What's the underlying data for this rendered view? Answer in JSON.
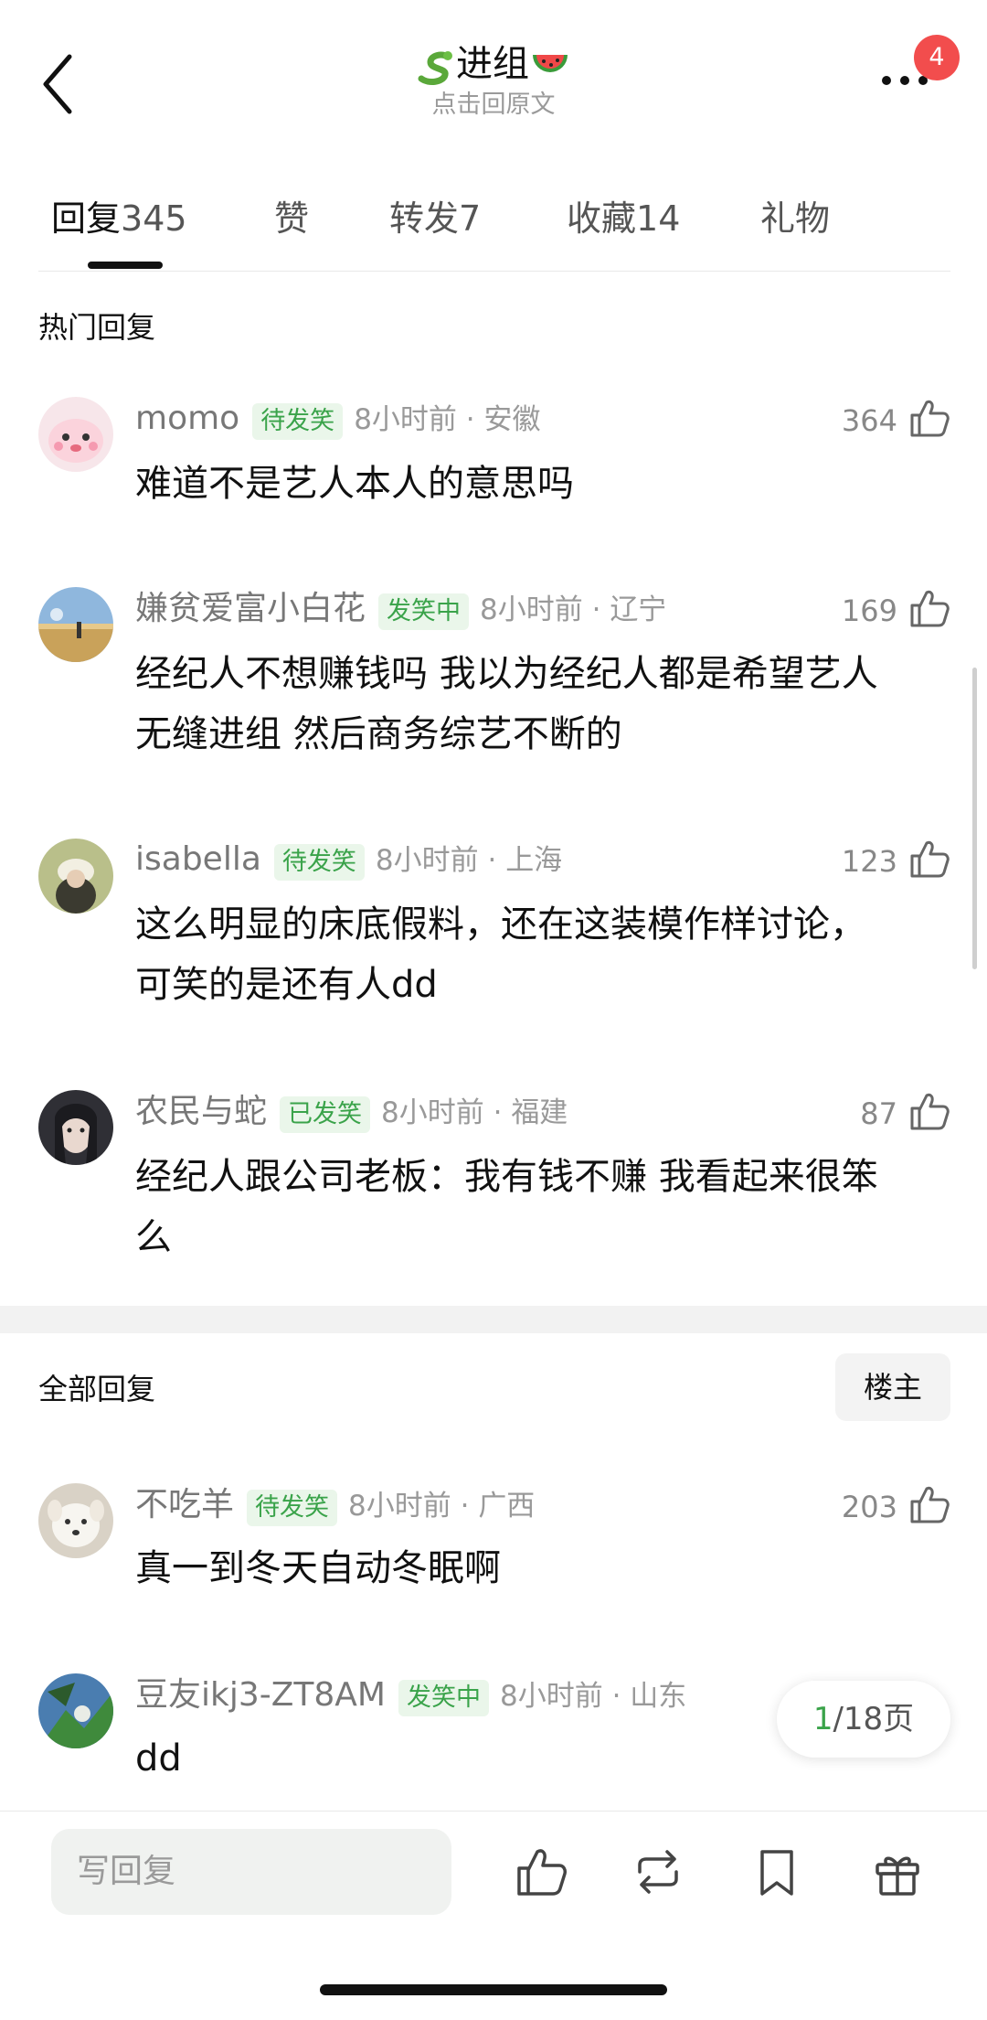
{
  "header": {
    "title": "进组",
    "subtitle": "点击回原文",
    "more_badge": "4",
    "icons": [
      "back-chevron-icon",
      "snake-emoji-icon",
      "watermelon-emoji-icon",
      "more-dots-icon"
    ]
  },
  "tabs": [
    {
      "label": "回复",
      "count": "345",
      "active": true
    },
    {
      "label": "赞",
      "count": "",
      "active": false
    },
    {
      "label": "转发",
      "count": "7",
      "active": false
    },
    {
      "label": "收藏",
      "count": "14",
      "active": false
    },
    {
      "label": "礼物",
      "count": "",
      "active": false
    }
  ],
  "hot_section": {
    "title": "热门回复"
  },
  "hot_comments": [
    {
      "name": "momo",
      "badge": "待发笑",
      "time": "8小时前",
      "location": "安徽",
      "likes": "364",
      "text": [
        "难道不是艺人本人的意思吗"
      ]
    },
    {
      "name": "嫌贫爱富小白花",
      "badge": "发笑中",
      "time": "8小时前",
      "location": "辽宁",
      "likes": "169",
      "text": [
        "经纪人不想赚钱吗 我以为经纪人都是希望艺人",
        "无缝进组 然后商务综艺不断的"
      ]
    },
    {
      "name": "isabella",
      "badge": "待发笑",
      "time": "8小时前",
      "location": "上海",
      "likes": "123",
      "text": [
        "这么明显的床底假料，还在这装模作样讨论，",
        "可笑的是还有人dd"
      ]
    },
    {
      "name": "农民与蛇",
      "badge": "已发笑",
      "time": "8小时前",
      "location": "福建",
      "likes": "87",
      "text": [
        "经纪人跟公司老板：我有钱不赚 我看起来很笨",
        "么"
      ]
    }
  ],
  "all_section": {
    "title": "全部回复",
    "filter_button": "楼主"
  },
  "all_comments": [
    {
      "name": "不吃羊",
      "badge": "待发笑",
      "time": "8小时前",
      "location": "广西",
      "likes": "203",
      "text": [
        "真一到冬天自动冬眠啊"
      ]
    },
    {
      "name": "豆友ikj3-ZT8AM",
      "badge": "发笑中",
      "time": "8小时前",
      "location": "山东",
      "likes": "",
      "text": [
        "dd"
      ]
    }
  ],
  "pager": {
    "current": "1",
    "rest": "/18页"
  },
  "bottom_bar": {
    "reply_placeholder": "写回复",
    "icons": [
      "thumb-up-icon",
      "repost-icon",
      "bookmark-icon",
      "gift-icon"
    ]
  },
  "colors": {
    "accent_green": "#3aa34a",
    "badge_bg": "#eaf6ea",
    "red_badge": "#f24d4d"
  }
}
